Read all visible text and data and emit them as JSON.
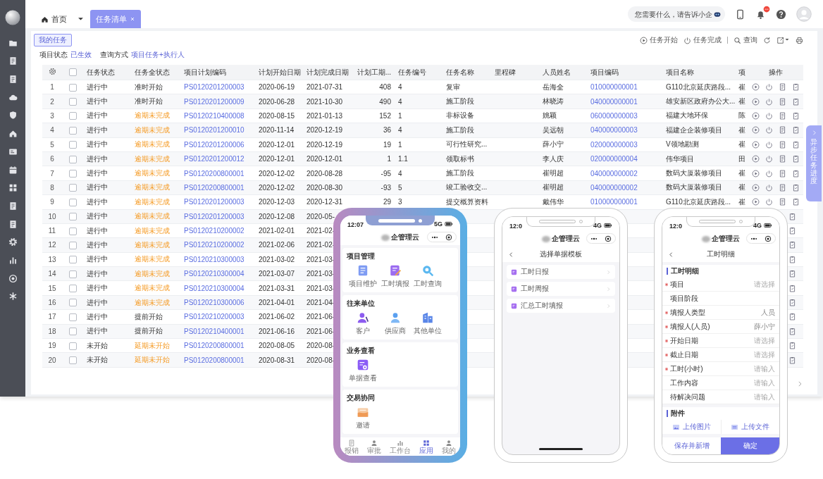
{
  "topbar": {
    "tabs": [
      {
        "label": "首页",
        "selected": false
      },
      {
        "label": "任务清单",
        "selected": true
      }
    ],
    "search": {
      "placeholder": "您需要什么，请告诉小企"
    }
  },
  "toolbar": {
    "my_tasks": "我的任务",
    "actions": [
      {
        "kind": "start",
        "label": "任务开始"
      },
      {
        "kind": "finish",
        "label": "任务完成"
      },
      {
        "kind": "query",
        "label": "查询"
      }
    ]
  },
  "filters": [
    {
      "label": "项目状态",
      "value": "已生效"
    },
    {
      "label": "查询方式",
      "value": "项目任务+执行人"
    }
  ],
  "table": {
    "select_all": false,
    "columns": [
      {
        "label": "任务状态",
        "kind": "text"
      },
      {
        "label": "任务全状态",
        "kind": "status"
      },
      {
        "label": "项目计划编码",
        "kind": "link"
      },
      {
        "label": "计划开始日期",
        "kind": "text"
      },
      {
        "label": "计划完成日期",
        "kind": "text"
      },
      {
        "label": "计划工期...",
        "kind": "number"
      },
      {
        "label": "任务编号",
        "kind": "text"
      },
      {
        "label": "任务名称",
        "kind": "text"
      },
      {
        "label": "里程碑",
        "kind": "text"
      },
      {
        "label": "人员姓名",
        "kind": "text"
      },
      {
        "label": "项目编码",
        "kind": "link"
      },
      {
        "label": "项目名称",
        "kind": "text"
      },
      {
        "label": "项",
        "kind": "text"
      },
      {
        "label": "操作",
        "kind": "actions"
      }
    ],
    "rows": [
      {
        "index": "1",
        "checked": false,
        "overdue": false,
        "cells": [
          "进行中",
          "准时开始",
          "PS0120201200003",
          "2020-06-19",
          "2021-07-31",
          "408",
          "4",
          "复审",
          null,
          "岳海全",
          "010000000001",
          "G110北京延庆路段...",
          "崔"
        ]
      },
      {
        "index": "2",
        "checked": false,
        "overdue": false,
        "cells": [
          "进行中",
          "准时开始",
          "PS0120201200009",
          "2020-06-28",
          "2021-10-30",
          "490",
          "4",
          "施工阶段",
          null,
          "林晓涛",
          "040000000001",
          "雄安新区政府办公大...",
          "崔"
        ]
      },
      {
        "index": "3",
        "checked": false,
        "overdue": true,
        "cells": [
          "进行中",
          "逾期未完成",
          "PS0120210400008",
          "2020-08-15",
          "2021-01-13",
          "152",
          "1",
          "非标设备",
          null,
          "姚颖",
          "060000000003",
          "福建大地环保",
          "陈"
        ]
      },
      {
        "index": "4",
        "checked": false,
        "overdue": true,
        "cells": [
          "进行中",
          "逾期未完成",
          "PS0120201200010",
          "2020-11-14",
          "2020-12-19",
          "36",
          "4",
          "施工阶段",
          null,
          "吴远朝",
          "040000000003",
          "福建企企装修项目",
          "崔"
        ]
      },
      {
        "index": "5",
        "checked": false,
        "overdue": true,
        "cells": [
          "进行中",
          "逾期未完成",
          "PS0120201200006",
          "2020-12-01",
          "2020-12-19",
          "19",
          "1",
          "可行性研究...",
          null,
          "薛小宁",
          "020000000003",
          "V领地勘测",
          "崔"
        ]
      },
      {
        "index": "6",
        "checked": false,
        "overdue": true,
        "cells": [
          "进行中",
          "逾期未完成",
          "PS0120201200012",
          "2020-12-01",
          "2020-12-01",
          "1",
          "1.1",
          "领取标书",
          null,
          "李人庆",
          "020000000004",
          "伟华项目",
          "田"
        ]
      },
      {
        "index": "7",
        "checked": false,
        "overdue": true,
        "cells": [
          "进行中",
          "逾期未完成",
          "PS0120200800001",
          "2020-12-02",
          "2020-08-28",
          "-95",
          "4",
          "施工阶段",
          null,
          "崔明超",
          "040000000002",
          "数码大厦装修项目",
          "崔"
        ]
      },
      {
        "index": "8",
        "checked": false,
        "overdue": true,
        "cells": [
          "进行中",
          "逾期未完成",
          "PS0120200800001",
          "2020-12-02",
          "2020-08-30",
          "-93",
          "5",
          "竣工验收交...",
          null,
          "崔明超",
          "040000000002",
          "数码大厦装修项目",
          "崔"
        ]
      },
      {
        "index": "9",
        "checked": false,
        "overdue": true,
        "cells": [
          "进行中",
          "逾期未完成",
          "PS0120201200003",
          "2020-12-03",
          "2020-12-31",
          "29",
          "3",
          "提交概算资料",
          null,
          "戴伟华",
          "010000000001",
          "G110北京延庆路段...",
          "崔"
        ]
      },
      {
        "index": "10",
        "checked": false,
        "overdue": true,
        "cells": [
          "进行中",
          "逾期未完成",
          "PS0120201200003",
          "2020-12-08",
          "2020-05-"
        ]
      },
      {
        "index": "11",
        "checked": false,
        "overdue": true,
        "cells": [
          "进行中",
          "逾期未完成",
          "PS0120210200002",
          "2021-02-01",
          "2021-02-"
        ]
      },
      {
        "index": "12",
        "checked": false,
        "overdue": true,
        "cells": [
          "进行中",
          "逾期未完成",
          "PS0120210200002",
          "2021-02-06",
          "2021-02-"
        ]
      },
      {
        "index": "13",
        "checked": false,
        "overdue": true,
        "cells": [
          "进行中",
          "逾期未完成",
          "PS0120210300003",
          "2021-03-02",
          "2021-03-"
        ]
      },
      {
        "index": "14",
        "checked": false,
        "overdue": true,
        "cells": [
          "进行中",
          "逾期未完成",
          "PS0120210300004",
          "2021-03-07",
          "2021-03-"
        ]
      },
      {
        "index": "15",
        "checked": false,
        "overdue": true,
        "cells": [
          "进行中",
          "逾期未完成",
          "PS0120210300004",
          "2021-03-31",
          "2021-03-"
        ]
      },
      {
        "index": "16",
        "checked": false,
        "overdue": true,
        "cells": [
          "进行中",
          "逾期未完成",
          "PS0120210300006",
          "2021-04-01",
          "2021-04-"
        ]
      },
      {
        "index": "17",
        "checked": false,
        "overdue": false,
        "cells": [
          "进行中",
          "提前开始",
          "PS0120210200003",
          "2021-06-02",
          "2021-06-"
        ]
      },
      {
        "index": "18",
        "checked": false,
        "overdue": false,
        "cells": [
          "进行中",
          "提前开始",
          "PS0120210400001",
          "2021-06-16",
          "2021-06-"
        ]
      },
      {
        "index": "19",
        "checked": false,
        "overdue": true,
        "cells": [
          "未开始",
          "延期未开始",
          "PS0120200800001",
          "2020-08-05",
          "2020-08-"
        ]
      },
      {
        "index": "20",
        "checked": false,
        "overdue": true,
        "cells": [
          "未开始",
          "延期未开始",
          "PS0120200800001",
          "2020-08-31",
          "2020-08-"
        ]
      }
    ]
  },
  "side_tab": {
    "label": "异步任务进度"
  },
  "phones": [
    {
      "kind": "home",
      "time": "12:07",
      "network": "5G",
      "app_title": "企管理云",
      "sections": [
        {
          "title": "项目管理",
          "items": [
            {
              "kind": "doc",
              "label": "项目维护"
            },
            {
              "kind": "note",
              "label": "工时填报"
            },
            {
              "kind": "search",
              "label": "工时查询"
            }
          ]
        },
        {
          "title": "往来单位",
          "items": [
            {
              "kind": "person",
              "label": "客户"
            },
            {
              "kind": "person2",
              "label": "供应商"
            },
            {
              "kind": "building",
              "label": "其他单位"
            }
          ]
        },
        {
          "title": "业务查看",
          "items": [
            {
              "kind": "docview",
              "label": "单据查看"
            }
          ]
        },
        {
          "title": "交易协同",
          "items": [
            {
              "kind": "mail",
              "label": "邀请"
            }
          ]
        }
      ],
      "tabbar": [
        {
          "kind": "doc",
          "label": "报销",
          "selected": false
        },
        {
          "kind": "person",
          "label": "审批",
          "selected": false
        },
        {
          "kind": "bars",
          "label": "工作台",
          "selected": false
        },
        {
          "kind": "grid",
          "label": "应用",
          "selected": true
        },
        {
          "kind": "person",
          "label": "我的",
          "selected": false
        }
      ]
    },
    {
      "kind": "list",
      "time": "12:0",
      "network": "4G",
      "app_title": "企管理云",
      "page_title": "选择单据模板",
      "items": [
        {
          "label": "工时日报"
        },
        {
          "label": "工时周报"
        },
        {
          "label": "汇总工时填报"
        }
      ]
    },
    {
      "kind": "form",
      "time": "12:0",
      "network": "4G",
      "app_title": "企管理云",
      "page_title": "工时明细",
      "section_title": "工时明细",
      "fields": [
        {
          "label": "项目",
          "required": true,
          "placeholder": "请选择"
        },
        {
          "label": "项目阶段",
          "required": false
        },
        {
          "label": "填报人类型",
          "required": true,
          "value": "人员"
        },
        {
          "label": "填报人(人员)",
          "required": true,
          "value": "薛小宁"
        },
        {
          "label": "开始日期",
          "required": true,
          "placeholder": "请选择"
        },
        {
          "label": "截止日期",
          "required": true,
          "placeholder": "请选择"
        },
        {
          "label": "工时(小时)",
          "required": true,
          "placeholder": "请输入"
        },
        {
          "label": "工作内容",
          "required": false,
          "placeholder": "请输入"
        },
        {
          "label": "待解决问题",
          "required": false,
          "placeholder": "请输入"
        }
      ],
      "attachment_title": "附件",
      "uploads": [
        {
          "kind": "image",
          "label": "上传图片"
        },
        {
          "kind": "file",
          "label": "上传文件"
        }
      ],
      "buttons": [
        {
          "label": "保存并新增",
          "primary": false
        },
        {
          "label": "确定",
          "primary": true
        }
      ]
    }
  ]
}
